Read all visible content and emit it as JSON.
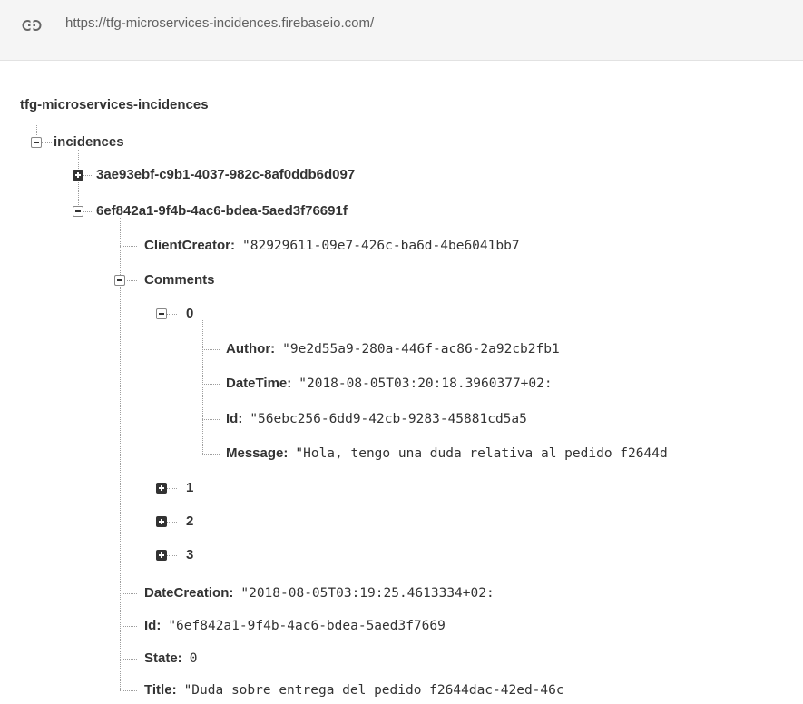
{
  "url": "https://tfg-microservices-incidences.firebaseio.com/",
  "root_key": "tfg-microservices-incidences",
  "incidences_key": "incidences",
  "incidence_1_key": "3ae93ebf-c9b1-4037-982c-8af0ddb6d097",
  "incidence_2_key": "6ef842a1-9f4b-4ac6-bdea-5aed3f76691f",
  "fields": {
    "client_creator": {
      "key": "ClientCreator:",
      "value": "\"82929611-09e7-426c-ba6d-4be6041bb7"
    },
    "comments_key": "Comments",
    "comment_0": {
      "key": "0",
      "author": {
        "key": "Author:",
        "value": "\"9e2d55a9-280a-446f-ac86-2a92cb2fb1"
      },
      "datetime": {
        "key": "DateTime:",
        "value": "\"2018-08-05T03:20:18.3960377+02:"
      },
      "id": {
        "key": "Id:",
        "value": "\"56ebc256-6dd9-42cb-9283-45881cd5a5"
      },
      "message": {
        "key": "Message:",
        "value": "\"Hola, tengo una duda relativa al pedido f2644d"
      }
    },
    "comment_1_key": "1",
    "comment_2_key": "2",
    "comment_3_key": "3",
    "date_creation": {
      "key": "DateCreation:",
      "value": "\"2018-08-05T03:19:25.4613334+02:"
    },
    "id": {
      "key": "Id:",
      "value": "\"6ef842a1-9f4b-4ac6-bdea-5aed3f7669"
    },
    "state": {
      "key": "State:",
      "value": "0"
    },
    "title": {
      "key": "Title:",
      "value": "\"Duda sobre entrega del pedido f2644dac-42ed-46c"
    }
  }
}
